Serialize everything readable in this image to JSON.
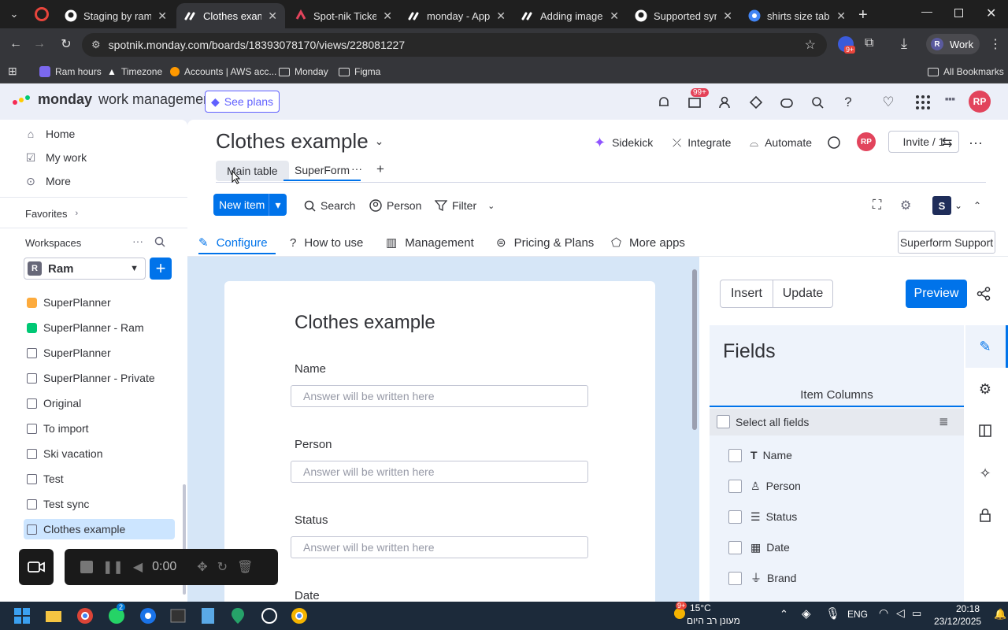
{
  "browser": {
    "tabs": [
      {
        "title": "Staging by ramar",
        "active": false,
        "icon": "github-icon"
      },
      {
        "title": "Clothes example",
        "active": true,
        "icon": "monday-icon"
      },
      {
        "title": "Spot-nik Tickets",
        "active": false,
        "icon": "spotnik-icon"
      },
      {
        "title": "monday - Apps",
        "active": false,
        "icon": "monday-icon"
      },
      {
        "title": "Adding images in",
        "active": false,
        "icon": "monday-icon"
      },
      {
        "title": "Supported sync",
        "active": false,
        "icon": "github-icon"
      },
      {
        "title": "shirts size table",
        "active": false,
        "icon": "chrome-icon"
      }
    ],
    "url": "spotnik.monday.com/boards/18393078170/views/228081227",
    "profile_label": "Work",
    "profile_initial": "R",
    "extension_badge": "9+",
    "bookmarks": [
      "Ram hours",
      "Timezone",
      "Accounts | AWS acc...",
      "Monday",
      "Figma"
    ],
    "all_bookmarks": "All Bookmarks"
  },
  "topbar": {
    "logo_bold": "monday",
    "logo_rest": "work management",
    "see_plans": "See plans",
    "notif_badge": "99+",
    "avatar": "RP"
  },
  "sidebar": {
    "nav": [
      {
        "label": "Home",
        "icon": "home-icon"
      },
      {
        "label": "My work",
        "icon": "calendar-check-icon"
      },
      {
        "label": "More",
        "icon": "more-circle-icon"
      }
    ],
    "favorites": "Favorites",
    "workspaces": "Workspaces",
    "workspace_name": "Ram",
    "workspace_initial": "R",
    "boards": [
      {
        "label": "SuperPlanner",
        "icon": "planner-icon"
      },
      {
        "label": "SuperPlanner - Ram",
        "icon": "planner-icon"
      },
      {
        "label": "SuperPlanner",
        "icon": "board-icon"
      },
      {
        "label": "SuperPlanner - Private",
        "icon": "board-lock-icon"
      },
      {
        "label": "Original",
        "icon": "board-icon"
      },
      {
        "label": "To import",
        "icon": "board-icon"
      },
      {
        "label": "Ski vacation",
        "icon": "board-icon"
      },
      {
        "label": "Test",
        "icon": "board-icon"
      },
      {
        "label": "Test sync",
        "icon": "board-icon"
      },
      {
        "label": "Clothes example",
        "icon": "board-icon",
        "selected": true
      }
    ]
  },
  "board": {
    "title": "Clothes example",
    "sidekick": "Sidekick",
    "integrate": "Integrate",
    "automate": "Automate",
    "avatar": "RP",
    "invite": "Invite / 1",
    "tabs": [
      "Main table",
      "SuperForm"
    ],
    "new_item": "New item",
    "tools": [
      "Search",
      "Person",
      "Filter"
    ]
  },
  "superform": {
    "menu": [
      "Configure",
      "How to use",
      "Management",
      "Pricing & Plans",
      "More apps"
    ],
    "support": "Superform Support",
    "form_title": "Clothes example",
    "fields": [
      {
        "label": "Name",
        "placeholder": "Answer will be written here"
      },
      {
        "label": "Person",
        "placeholder": "Answer will be written here"
      },
      {
        "label": "Status",
        "placeholder": "Answer will be written here"
      },
      {
        "label": "Date",
        "placeholder": ""
      }
    ],
    "insert": "Insert",
    "update": "Update",
    "preview": "Preview",
    "panel_title": "Fields",
    "item_columns": "Item Columns",
    "select_all": "Select all fields",
    "columns": [
      {
        "label": "Name",
        "icon": "text-icon"
      },
      {
        "label": "Person",
        "icon": "person-icon"
      },
      {
        "label": "Status",
        "icon": "status-icon"
      },
      {
        "label": "Date",
        "icon": "calendar-icon"
      },
      {
        "label": "Brand",
        "icon": "dropdown-icon"
      }
    ]
  },
  "recorder": {
    "time": "0:00"
  },
  "taskbar": {
    "weather_temp": "15°C",
    "weather_text": "מעונן רב היום",
    "weather_badge": "9+",
    "chat_badge": "2",
    "lang": "ENG",
    "time": "20:18",
    "date": "23/12/2025"
  },
  "colors": {
    "accent": "#0073ea",
    "brand_purple": "#6161ff",
    "avatar": "#e2445c"
  }
}
